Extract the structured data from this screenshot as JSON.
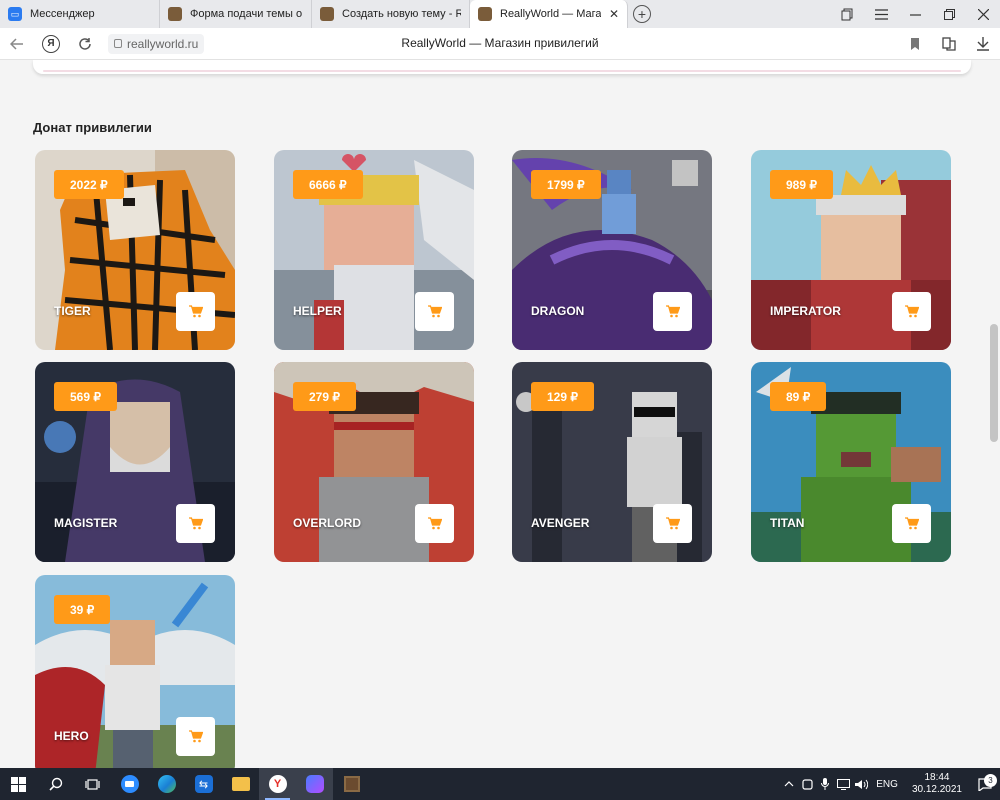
{
  "browser": {
    "tabs": [
      {
        "title": "Мессенджер",
        "favicon": "messenger-icon",
        "color": "#2b7bf0"
      },
      {
        "title": "Форма подачи темы о на",
        "favicon": "forum-favicon-icon",
        "color": "#7a5c3a"
      },
      {
        "title": "Создать новую тему - Rea",
        "favicon": "forum-favicon-icon",
        "color": "#7a5c3a"
      },
      {
        "title": "ReallyWorld — Магазин",
        "favicon": "reallyworld-favicon-icon",
        "color": "#7a5c3a"
      }
    ],
    "close_glyph": "✕",
    "new_tab_glyph": "+",
    "url": "reallyworld.ru",
    "page_title": "ReallyWorld — Магазин привилегий"
  },
  "section_title": "Донат привилегии",
  "cards": [
    {
      "name": "TIGER",
      "price": "2022 ₽",
      "art": "tiger"
    },
    {
      "name": "HELPER",
      "price": "6666 ₽",
      "art": "helper"
    },
    {
      "name": "DRAGON",
      "price": "1799 ₽",
      "art": "dragon"
    },
    {
      "name": "IMPERATOR",
      "price": "989 ₽",
      "art": "imperator"
    },
    {
      "name": "MAGISTER",
      "price": "569 ₽",
      "art": "magister"
    },
    {
      "name": "OVERLORD",
      "price": "279 ₽",
      "art": "overlord"
    },
    {
      "name": "AVENGER",
      "price": "129 ₽",
      "art": "avenger"
    },
    {
      "name": "TITAN",
      "price": "89 ₽",
      "art": "titan"
    },
    {
      "name": "HERO",
      "price": "39 ₽",
      "art": "hero"
    }
  ],
  "colors": {
    "accent": "#ff9a18",
    "cart_icon": "#ff9a18"
  },
  "taskbar": {
    "lang": "ENG",
    "time": "18:44",
    "date": "30.12.2021",
    "notifications": "3"
  }
}
